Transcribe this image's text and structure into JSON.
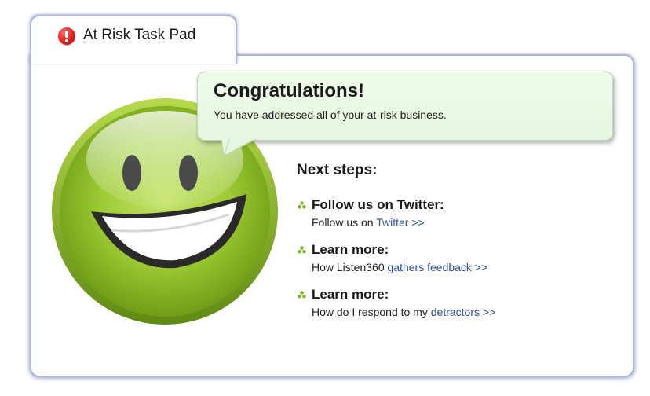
{
  "tab": {
    "title": "At Risk Task Pad",
    "icon": "exclamation-circle-icon",
    "icon_color": "#e01d1d"
  },
  "bubble": {
    "title": "Congratulations!",
    "message": "You have addressed all of your at-risk business."
  },
  "next_steps": {
    "heading": "Next steps:",
    "items": [
      {
        "title": "Follow us on Twitter:",
        "desc_prefix": "Follow us on ",
        "link_text": "Twitter >>"
      },
      {
        "title": "Learn more:",
        "desc_prefix": "How Listen360 ",
        "link_text": "gathers feedback >>"
      },
      {
        "title": "Learn more:",
        "desc_prefix": "How do I respond to my ",
        "link_text": "detractors >>"
      }
    ]
  },
  "colors": {
    "accent_link": "#2e4f9a",
    "panel_border": "#aeb4d6",
    "bubble_bg": "#eefbea",
    "smiley_green": "#8fbf2a"
  },
  "icons": {
    "smiley": "smiley-face-icon",
    "bullet": "green-dots-bullet-icon"
  }
}
